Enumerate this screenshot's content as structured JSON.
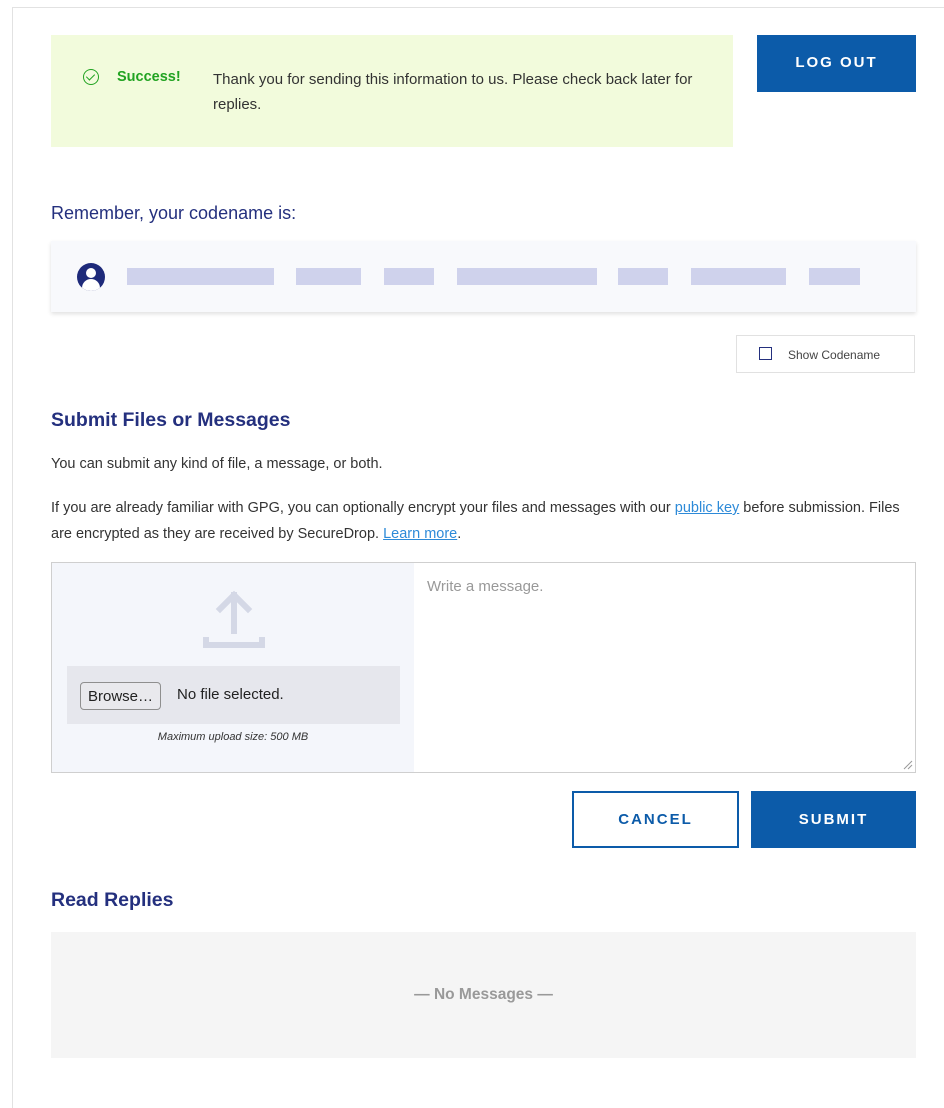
{
  "flash": {
    "icon": "check-circle-icon",
    "title": "Success!",
    "message": "Thank you for sending this information to us. Please check back later for replies.",
    "color": "#22a322"
  },
  "header": {
    "logout_label": "LOG OUT"
  },
  "codename": {
    "heading": "Remember, your codename is:",
    "avatar_icon": "user-icon",
    "show_label": "Show Codename",
    "show_checked": false
  },
  "submit": {
    "heading": "Submit Files or Messages",
    "intro": "You can submit any kind of file, a message, or both.",
    "gpg_text_1": "If you are already familiar with GPG, you can optionally encrypt your files and messages with our ",
    "public_key_link": "public key",
    "gpg_text_2": " before submission. Files are encrypted as they are received by SecureDrop. ",
    "learn_more_link": "Learn more",
    "gpg_text_3": ".",
    "upload_icon": "upload-icon",
    "browse_label": "Browse…",
    "file_status": "No file selected.",
    "max_size": "Maximum upload size: 500 MB",
    "message_placeholder": "Write a message.",
    "cancel_label": "CANCEL",
    "submit_label": "SUBMIT"
  },
  "replies": {
    "heading": "Read Replies",
    "empty_text": "— No Messages —"
  },
  "colors": {
    "primary": "#0c5ba9",
    "heading": "#24307e",
    "success_bg": "#f2fbdc",
    "link": "#2d8ad8"
  }
}
